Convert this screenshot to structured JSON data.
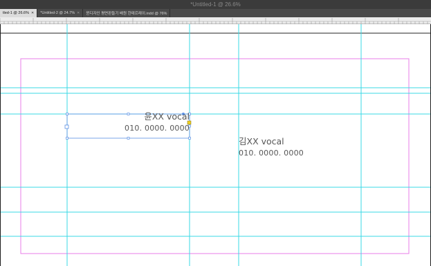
{
  "window": {
    "title": "*Untitled-1 @ 26.6%"
  },
  "tabs": [
    {
      "label": "tled-1 @ 26.6%",
      "active": true
    },
    {
      "label": "*Untitled-2 @ 24.7%",
      "active": false
    },
    {
      "label": "윈디자인 평면판들기 배원 한테르레이.indd @ 76%",
      "active": false
    }
  ],
  "cards": [
    {
      "name": "윤XX vocal",
      "phone": "010. 0000. 0000",
      "selected": true
    },
    {
      "name": "김XX vocal",
      "phone": "010. 0000. 0000",
      "selected": false
    }
  ],
  "colors": {
    "guide": "#38d8e6",
    "margin_guide": "#e87ee8",
    "selection": "#5b8fe3",
    "text": "#555555"
  }
}
